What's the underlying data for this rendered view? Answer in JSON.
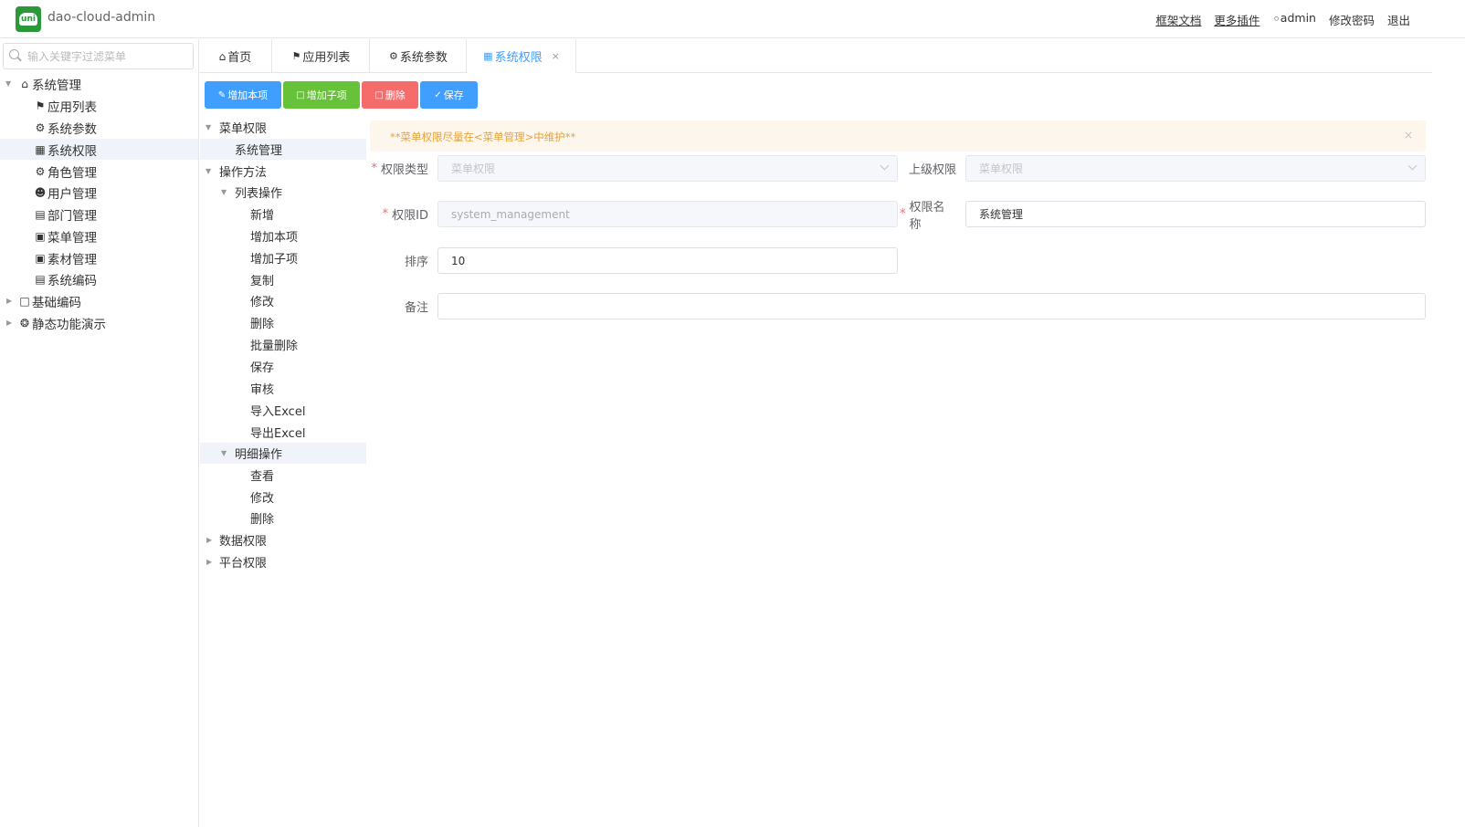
{
  "header": {
    "logo_text": "uni",
    "app_title": "dao-cloud-admin",
    "links": {
      "docs": "框架文档",
      "plugins": "更多插件",
      "user": "admin",
      "change_password": "修改密码",
      "logout": "退出"
    }
  },
  "sidebar": {
    "search_placeholder": "输入关键字过滤菜单",
    "items": [
      {
        "label": "系统管理",
        "icon": "home-icon"
      },
      {
        "label": "应用列表",
        "icon": "flag-icon"
      },
      {
        "label": "系统参数",
        "icon": "gear-icon"
      },
      {
        "label": "系统权限",
        "icon": "grid-icon"
      },
      {
        "label": "角色管理",
        "icon": "gear-icon"
      },
      {
        "label": "用户管理",
        "icon": "user-icon"
      },
      {
        "label": "部门管理",
        "icon": "building-icon"
      },
      {
        "label": "菜单管理",
        "icon": "apps-icon"
      },
      {
        "label": "素材管理",
        "icon": "image-icon"
      },
      {
        "label": "系统编码",
        "icon": "doc-icon"
      },
      {
        "label": "基础编码",
        "icon": "folder-icon"
      },
      {
        "label": "静态功能演示",
        "icon": "circle-icon"
      }
    ]
  },
  "tabs": [
    {
      "label": "首页",
      "icon": "home-icon"
    },
    {
      "label": "应用列表",
      "icon": "flag-icon"
    },
    {
      "label": "系统参数",
      "icon": "gear-icon"
    },
    {
      "label": "系统权限",
      "icon": "grid-icon",
      "close": "×"
    }
  ],
  "toolbar": {
    "add_item": "增加本项",
    "add_child": "增加子项",
    "delete": "删除",
    "save": "保存"
  },
  "tree": [
    {
      "label": "菜单权限"
    },
    {
      "label": "系统管理"
    },
    {
      "label": "操作方法"
    },
    {
      "label": "列表操作"
    },
    {
      "label": "新增"
    },
    {
      "label": "增加本项"
    },
    {
      "label": "增加子项"
    },
    {
      "label": "复制"
    },
    {
      "label": "修改"
    },
    {
      "label": "删除"
    },
    {
      "label": "批量删除"
    },
    {
      "label": "保存"
    },
    {
      "label": "审核"
    },
    {
      "label": "导入Excel"
    },
    {
      "label": "导出Excel"
    },
    {
      "label": "明细操作"
    },
    {
      "label": "查看"
    },
    {
      "label": "修改"
    },
    {
      "label": "删除"
    },
    {
      "label": "数据权限"
    },
    {
      "label": "平台权限"
    }
  ],
  "alert": {
    "message": "**菜单权限尽量在<菜单管理>中维护**",
    "close": "×"
  },
  "form": {
    "type_label": "权限类型",
    "type_value": "菜单权限",
    "parent_label": "上级权限",
    "parent_value": "菜单权限",
    "id_label": "权限ID",
    "id_value": "system_management",
    "name_label": "权限名称",
    "name_value": "系统管理",
    "sort_label": "排序",
    "sort_value": "10",
    "remark_label": "备注",
    "remark_value": "",
    "required_mark": "*"
  },
  "colors": {
    "primary": "#409eff",
    "success": "#67c23a",
    "danger": "#f56c6c",
    "warning": "#e6a23c",
    "brand": "#2b9939"
  }
}
